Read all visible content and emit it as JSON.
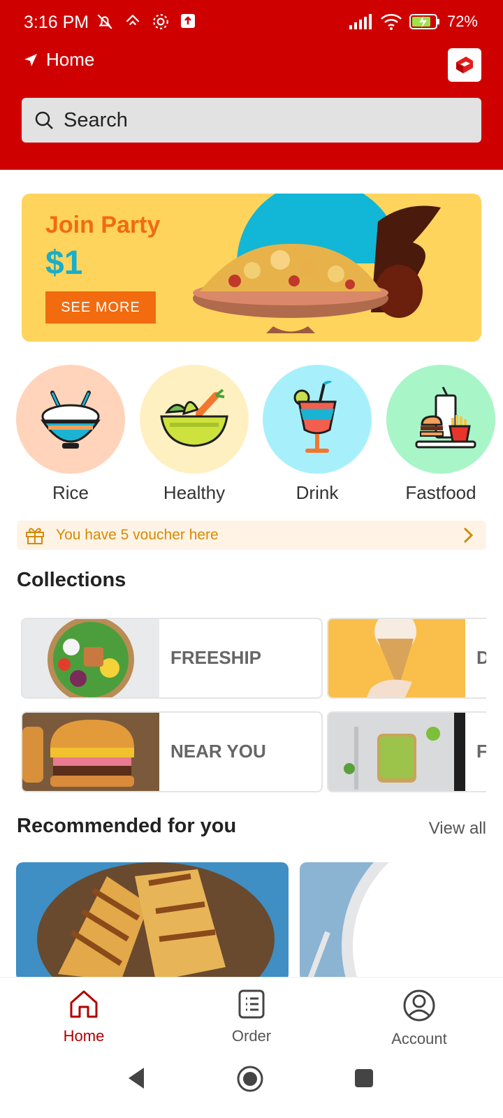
{
  "status_bar": {
    "time": "3:16 PM",
    "battery": "72%"
  },
  "header": {
    "location_label": "Home",
    "search_placeholder": "Search"
  },
  "banner": {
    "title": "Join Party",
    "price": "$1",
    "button_label": "SEE MORE"
  },
  "categories": [
    {
      "label": "Rice",
      "color": "#ffd4bb"
    },
    {
      "label": "Healthy",
      "color": "#fff0c2"
    },
    {
      "label": "Drink",
      "color": "#a7f0fb"
    },
    {
      "label": "Fastfood",
      "color": "#a8f5c8"
    }
  ],
  "voucher": {
    "text": "You have 5 voucher here"
  },
  "collections": {
    "title": "Collections",
    "items": [
      {
        "label": "FREESHIP"
      },
      {
        "label": "NEAR YOU"
      },
      {
        "label": "D"
      },
      {
        "label": "F"
      }
    ]
  },
  "recommended": {
    "title": "Recommended for you",
    "view_all": "View all"
  },
  "bottom_nav": {
    "home": "Home",
    "order": "Order",
    "account": "Account"
  },
  "colors": {
    "brand_red": "#cf0000",
    "accent_orange": "#f26b0f",
    "banner_yellow": "#ffd45c"
  }
}
